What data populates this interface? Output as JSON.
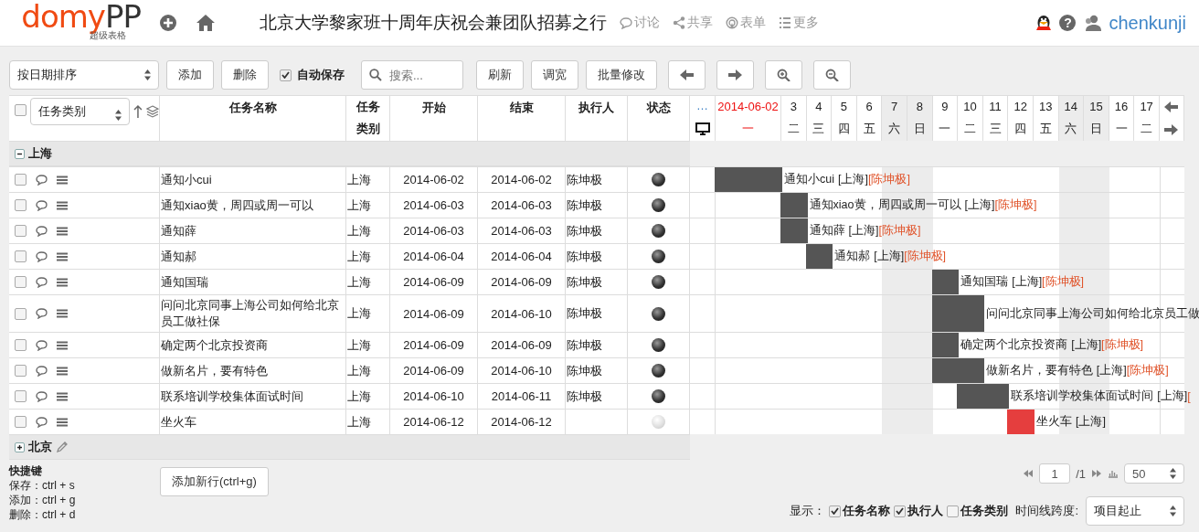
{
  "header": {
    "logo": {
      "main": "domy",
      "accent": "PP",
      "subtitle": "超级表格"
    },
    "title": "北京大学黎家班十周年庆祝会兼团队招募之行",
    "links": [
      {
        "kind": "discuss",
        "label": "讨论"
      },
      {
        "kind": "share",
        "label": "共享"
      },
      {
        "kind": "form",
        "label": "表单"
      },
      {
        "kind": "more",
        "label": "更多"
      }
    ],
    "help": "?",
    "username": "chenkunji"
  },
  "toolbar": {
    "sort": "按日期排序",
    "buttons_left": [
      "添加",
      "删除"
    ],
    "autosave": {
      "label": "自动保存",
      "checked": true
    },
    "search": {
      "placeholder": "搜索..."
    },
    "buttons_right": [
      "刷新",
      "调宽",
      "批量修改"
    ],
    "icon_buttons": [
      {
        "kind": "left"
      },
      {
        "kind": "right"
      },
      {
        "kind": "zoom-in"
      },
      {
        "kind": "zoom-out"
      }
    ]
  },
  "table": {
    "group_select": "任务类别",
    "select_all_checked": false,
    "columns": [
      "任务名称",
      "任务类别",
      "开始",
      "结束",
      "执行人",
      "状态"
    ],
    "timeline": {
      "more": "…",
      "days": [
        {
          "day": "2014-06-02",
          "weekday": "一",
          "today": true,
          "weekend": false
        },
        {
          "day": "3",
          "weekday": "二",
          "today": false,
          "weekend": false
        },
        {
          "day": "4",
          "weekday": "三",
          "today": false,
          "weekend": false
        },
        {
          "day": "5",
          "weekday": "四",
          "today": false,
          "weekend": false
        },
        {
          "day": "6",
          "weekday": "五",
          "today": false,
          "weekend": false
        },
        {
          "day": "7",
          "weekday": "六",
          "today": false,
          "weekend": true
        },
        {
          "day": "8",
          "weekday": "日",
          "today": false,
          "weekend": true
        },
        {
          "day": "9",
          "weekday": "一",
          "today": false,
          "weekend": false
        },
        {
          "day": "10",
          "weekday": "二",
          "today": false,
          "weekend": false
        },
        {
          "day": "11",
          "weekday": "三",
          "today": false,
          "weekend": false
        },
        {
          "day": "12",
          "weekday": "四",
          "today": false,
          "weekend": false
        },
        {
          "day": "13",
          "weekday": "五",
          "today": false,
          "weekend": false
        },
        {
          "day": "14",
          "weekday": "六",
          "today": false,
          "weekend": true
        },
        {
          "day": "15",
          "weekday": "日",
          "today": false,
          "weekend": true
        },
        {
          "day": "16",
          "weekday": "一",
          "today": false,
          "weekend": false
        },
        {
          "day": "17",
          "weekday": "二",
          "today": false,
          "weekend": false
        }
      ]
    },
    "groups": [
      {
        "name": "上海",
        "expanded": true,
        "editable": false,
        "rows": [
          {
            "checked": false,
            "name": "通知小cui",
            "category": "上海",
            "start": "2014-06-02",
            "end": "2014-06-02",
            "assignee": "陈坤极",
            "done": true,
            "color": "#555555",
            "bar_label": {
              "name": "通知小cui",
              "category": "[上海]",
              "assignee": "[陈坤极]"
            }
          },
          {
            "checked": false,
            "name": "通知xiao黄，周四或周一可以",
            "category": "上海",
            "start": "2014-06-03",
            "end": "2014-06-03",
            "assignee": "陈坤极",
            "done": true,
            "color": "#555555",
            "bar_label": {
              "name": "通知xiao黄，周四或周一可以",
              "category": "[上海]",
              "assignee": "[陈坤极]"
            }
          },
          {
            "checked": false,
            "name": "通知薛",
            "category": "上海",
            "start": "2014-06-03",
            "end": "2014-06-03",
            "assignee": "陈坤极",
            "done": true,
            "color": "#555555",
            "bar_label": {
              "name": "通知薛",
              "category": "[上海]",
              "assignee": "[陈坤极]"
            }
          },
          {
            "checked": false,
            "name": "通知郝",
            "category": "上海",
            "start": "2014-06-04",
            "end": "2014-06-04",
            "assignee": "陈坤极",
            "done": true,
            "color": "#555555",
            "bar_label": {
              "name": "通知郝",
              "category": "[上海]",
              "assignee": "[陈坤极]"
            }
          },
          {
            "checked": false,
            "name": "通知国瑞",
            "category": "上海",
            "start": "2014-06-09",
            "end": "2014-06-09",
            "assignee": "陈坤极",
            "done": true,
            "color": "#555555",
            "bar_label": {
              "name": "通知国瑞",
              "category": "[上海]",
              "assignee": "[陈坤极]"
            }
          },
          {
            "checked": false,
            "name": "问问北京同事上海公司如何给北京员工做社保",
            "category": "上海",
            "start": "2014-06-09",
            "end": "2014-06-10",
            "assignee": "陈坤极",
            "done": true,
            "color": "#555555",
            "bar_label": {
              "name": "问问北京同事上海公司如何给北京员工做"
            }
          },
          {
            "checked": false,
            "name": "确定两个北京投资商",
            "category": "上海",
            "start": "2014-06-09",
            "end": "2014-06-09",
            "assignee": "陈坤极",
            "done": true,
            "color": "#555555",
            "bar_label": {
              "name": "确定两个北京投资商",
              "category": "[上海]",
              "assignee": "[陈坤极]"
            }
          },
          {
            "checked": false,
            "name": "做新名片，要有特色",
            "category": "上海",
            "start": "2014-06-09",
            "end": "2014-06-10",
            "assignee": "陈坤极",
            "done": true,
            "color": "#555555",
            "bar_label": {
              "name": "做新名片，要有特色",
              "category": "[上海]",
              "assignee": "[陈坤极]"
            }
          },
          {
            "checked": false,
            "name": "联系培训学校集体面试时间",
            "category": "上海",
            "start": "2014-06-10",
            "end": "2014-06-11",
            "assignee": "陈坤极",
            "done": true,
            "color": "#555555",
            "bar_label": {
              "name": "联系培训学校集体面试时间",
              "category": "[上海]",
              "assignee": "["
            }
          },
          {
            "checked": false,
            "name": "坐火车",
            "category": "上海",
            "start": "2014-06-12",
            "end": "2014-06-12",
            "done": false,
            "color": "#e53e3e",
            "bar_label": {
              "name": "坐火车",
              "category": "[上海]"
            }
          }
        ]
      },
      {
        "name": "北京",
        "expanded": false,
        "editable": true
      }
    ]
  },
  "shortcuts": {
    "title": "快捷键",
    "items": [
      "保存：ctrl + s",
      "添加：ctrl + g",
      "删除：ctrl + d"
    ]
  },
  "add_row_button": "添加新行(ctrl+g)",
  "pager": {
    "page": "1",
    "total": "/1",
    "per_page": "50"
  },
  "display": {
    "label": "显示：",
    "options": [
      {
        "label": "任务名称",
        "checked": true
      },
      {
        "label": "执行人",
        "checked": true
      },
      {
        "label": "任务类别",
        "checked": false
      }
    ],
    "span_label": "时间线跨度:",
    "span": "项目起止"
  }
}
